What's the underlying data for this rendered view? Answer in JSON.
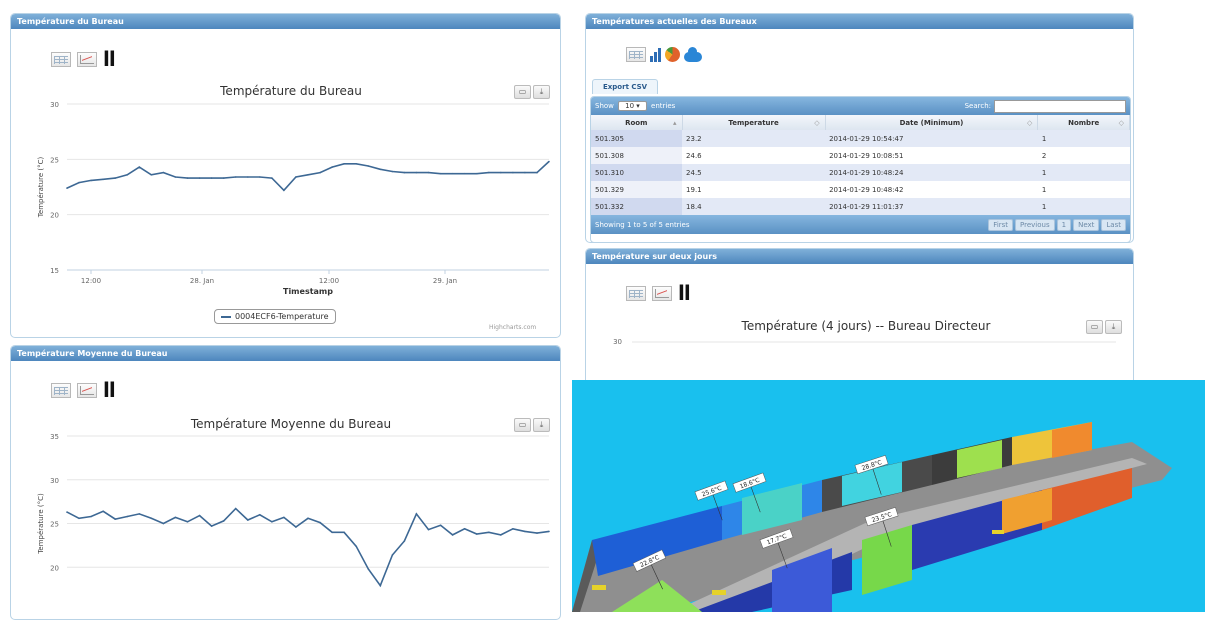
{
  "panels": {
    "bureau": {
      "header": "Température du Bureau",
      "chart_title": "Température du Bureau",
      "y_label": "Température (°C)",
      "x_label": "Timestamp",
      "y_ticks": [
        "30",
        "25",
        "20",
        "15"
      ],
      "x_ticks": [
        "12:00",
        "28. Jan",
        "12:00",
        "29. Jan"
      ],
      "legend": "0004ECF6-Temperature",
      "credits": "Highcharts.com"
    },
    "moyenne": {
      "header": "Température Moyenne du Bureau",
      "chart_title": "Température Moyenne du Bureau",
      "y_label": "Température (°C)",
      "y_ticks": [
        "35",
        "30",
        "25",
        "20"
      ]
    },
    "actuelles": {
      "header": "Températures actuelles des Bureaux",
      "export_label": "Export CSV",
      "show_label": "Show",
      "show_value": "10",
      "entries_label": "entries",
      "search_label": "Search:",
      "columns": [
        "Room",
        "Temperature",
        "Date (Minimum)",
        "Nombre"
      ],
      "rows": [
        [
          "501.305",
          "23.2",
          "2014-01-29 10:54:47",
          "1"
        ],
        [
          "501.308",
          "24.6",
          "2014-01-29 10:08:51",
          "2"
        ],
        [
          "501.310",
          "24.5",
          "2014-01-29 10:48:24",
          "1"
        ],
        [
          "501.329",
          "19.1",
          "2014-01-29 10:48:42",
          "1"
        ],
        [
          "501.332",
          "18.4",
          "2014-01-29 11:01:37",
          "1"
        ]
      ],
      "info": "Showing 1 to 5 of 5 entries",
      "pager": [
        "First",
        "Previous",
        "1",
        "Next",
        "Last"
      ]
    },
    "deux_jours": {
      "header": "Température sur deux jours",
      "chart_title": "Température (4 jours) -- Bureau Directeur",
      "y_tick": "30"
    }
  },
  "scene": {
    "labels": [
      "22.8°C",
      "17.7°C",
      "25.6°C",
      "18.6°C",
      "28.8°C",
      "23.5°C"
    ]
  },
  "chart_data": [
    {
      "type": "line",
      "title": "Température du Bureau",
      "xlabel": "Timestamp",
      "ylabel": "Température (°C)",
      "ylim": [
        15,
        30
      ],
      "x_tick_labels": [
        "12:00",
        "28. Jan",
        "12:00",
        "29. Jan"
      ],
      "series": [
        {
          "name": "0004ECF6-Temperature",
          "values": [
            22.4,
            22.9,
            23.1,
            23.2,
            23.3,
            23.6,
            24.3,
            23.6,
            23.8,
            23.4,
            23.3,
            23.3,
            23.3,
            23.3,
            23.4,
            23.4,
            23.4,
            23.3,
            22.2,
            23.4,
            23.6,
            23.8,
            24.3,
            24.6,
            24.6,
            24.4,
            24.1,
            23.9,
            23.8,
            23.8,
            23.8,
            23.7,
            23.7,
            23.7,
            23.7,
            23.8,
            23.8,
            23.8,
            23.8,
            23.8,
            24.8
          ]
        }
      ],
      "grid": true,
      "legend": "bottom-center"
    },
    {
      "type": "line",
      "title": "Température Moyenne du Bureau",
      "ylabel": "Température (°C)",
      "ylim": [
        15,
        35
      ],
      "series": [
        {
          "values": [
            26.3,
            25.6,
            25.8,
            26.4,
            25.5,
            25.8,
            26.1,
            25.6,
            25.0,
            25.7,
            25.2,
            25.9,
            24.7,
            25.3,
            26.7,
            25.4,
            26.0,
            25.2,
            25.7,
            24.6,
            25.6,
            25.1,
            24.0,
            24.0,
            22.4,
            19.8,
            17.9,
            21.4,
            23.0,
            26.1,
            24.3,
            24.8,
            23.7,
            24.4,
            23.8,
            24.0,
            23.7,
            24.4,
            24.1,
            23.9,
            24.1
          ]
        }
      ],
      "grid": true
    }
  ]
}
